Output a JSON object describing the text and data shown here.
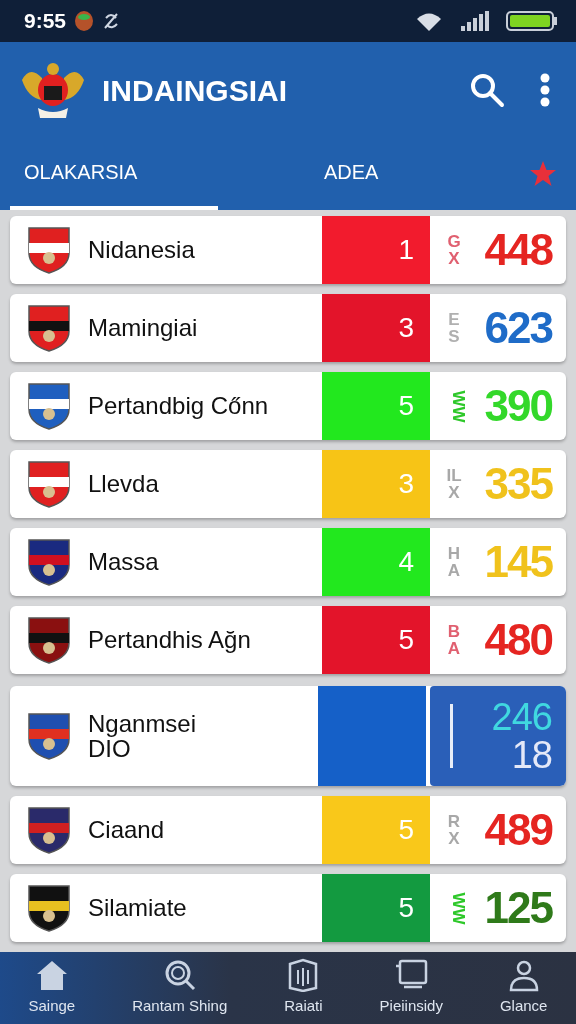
{
  "status_bar": {
    "time": "9:55"
  },
  "app_bar": {
    "title": "INDAINGSIAI"
  },
  "tabs": [
    {
      "label": "OLAKARSIA",
      "selected": true
    },
    {
      "label": "ADEA",
      "selected": false
    }
  ],
  "rows": [
    {
      "kind": "standard",
      "name": "Nidanesia",
      "rank": {
        "value": "1",
        "color": "#f21b2d"
      },
      "letters": {
        "chars": [
          "G",
          "X"
        ],
        "color": "#e06070"
      },
      "score": {
        "value": "448",
        "color": "#e52521"
      }
    },
    {
      "kind": "standard",
      "name": "Mamingiai",
      "rank": {
        "value": "3",
        "color": "#e3142a"
      },
      "letters": {
        "chars": [
          "E",
          "S"
        ],
        "color": "#b0b0b0"
      },
      "score": {
        "value": "623",
        "color": "#1f6cc8"
      }
    },
    {
      "kind": "standard",
      "name": "Pertandbig Cőnn",
      "rank": {
        "value": "5",
        "color": "#22e81e"
      },
      "letters": {
        "chars": [
          "W",
          "W"
        ],
        "color": "#2ec82a"
      },
      "score": {
        "value": "390",
        "color": "#33d82a"
      }
    },
    {
      "kind": "standard",
      "name": "Llevda",
      "rank": {
        "value": "3",
        "color": "#f7c416"
      },
      "letters": {
        "chars": [
          "IL",
          "X"
        ],
        "color": "#a8a8a8"
      },
      "score": {
        "value": "335",
        "color": "#f0c21c"
      }
    },
    {
      "kind": "standard",
      "name": "Massa",
      "rank": {
        "value": "4",
        "color": "#22e81e"
      },
      "letters": {
        "chars": [
          "H",
          "A"
        ],
        "color": "#a8a8a8"
      },
      "score": {
        "value": "145",
        "color": "#f0c21c"
      }
    },
    {
      "kind": "standard",
      "name": "Pertandhis Ağn",
      "rank": {
        "value": "5",
        "color": "#e3142a"
      },
      "letters": {
        "chars": [
          "B",
          "A"
        ],
        "color": "#e06070"
      },
      "score": {
        "value": "480",
        "color": "#e52521"
      }
    },
    {
      "kind": "split",
      "name": "Nganmsei",
      "name_line_2": "DIO",
      "rank": {
        "color": "#1560c8"
      },
      "score": {
        "value": "246",
        "color": "#40d8e0"
      },
      "score_2": {
        "value": "18"
      }
    },
    {
      "kind": "standard",
      "name": "Ciaand",
      "rank": {
        "value": "5",
        "color": "#f9c81a"
      },
      "letters": {
        "chars": [
          "R",
          "X"
        ],
        "color": "#a8a8a8"
      },
      "score": {
        "value": "489",
        "color": "#e52521"
      }
    },
    {
      "kind": "standard",
      "name": "Silamiate",
      "rank": {
        "value": "5",
        "color": "#139a40"
      },
      "letters": {
        "chars": [
          "W",
          "W"
        ],
        "color": "#2ec82a"
      },
      "score": {
        "value": "125",
        "color": "#2f7a1a"
      }
    }
  ],
  "bottom_nav": [
    {
      "label": "Sainge"
    },
    {
      "label": "Rantam Shing"
    },
    {
      "label": "Raiati"
    },
    {
      "label": "Pieiinsidy"
    },
    {
      "label": "Glance"
    }
  ]
}
